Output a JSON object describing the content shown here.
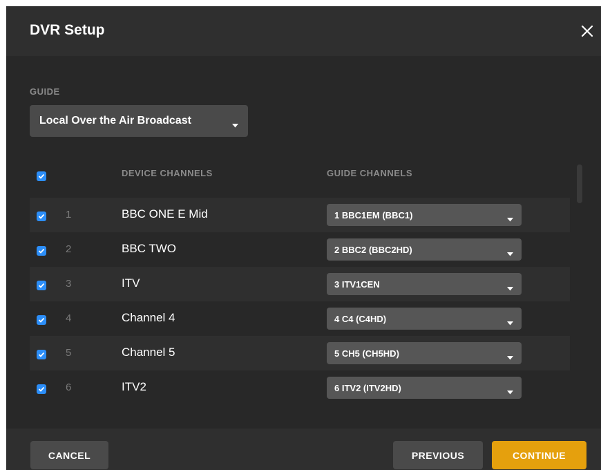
{
  "dialog": {
    "title": "DVR Setup"
  },
  "guide": {
    "label": "GUIDE",
    "selected": "Local Over the Air Broadcast"
  },
  "table": {
    "headers": {
      "device": "DEVICE CHANNELS",
      "guide": "GUIDE CHANNELS"
    },
    "rows": [
      {
        "num": "1",
        "name": "BBC ONE E Mid",
        "guide": "1 BBC1EM (BBC1)",
        "checked": true
      },
      {
        "num": "2",
        "name": "BBC TWO",
        "guide": "2 BBC2 (BBC2HD)",
        "checked": true
      },
      {
        "num": "3",
        "name": "ITV",
        "guide": "3 ITV1CEN",
        "checked": true
      },
      {
        "num": "4",
        "name": "Channel 4",
        "guide": "4 C4 (C4HD)",
        "checked": true
      },
      {
        "num": "5",
        "name": "Channel 5",
        "guide": "5 CH5 (CH5HD)",
        "checked": true
      },
      {
        "num": "6",
        "name": "ITV2",
        "guide": "6 ITV2 (ITV2HD)",
        "checked": true
      }
    ]
  },
  "footer": {
    "cancel_label": "CANCEL",
    "previous_label": "PREVIOUS",
    "continue_label": "CONTINUE"
  },
  "colors": {
    "accent": "#e5a00d",
    "checkbox": "#2c8ef8",
    "background": "#282828"
  },
  "icons": {
    "close": "close-icon",
    "caret": "chevron-down-icon",
    "check": "checkmark-icon"
  }
}
